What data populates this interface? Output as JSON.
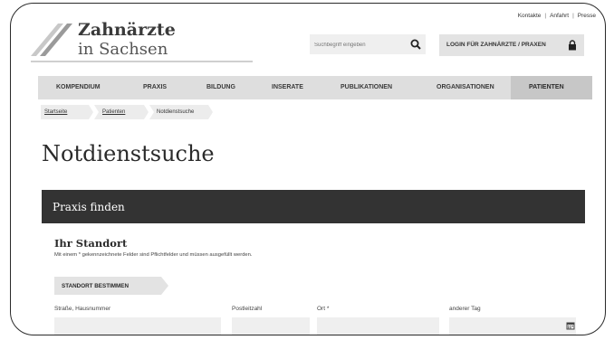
{
  "header": {
    "logo_line1": "Zahnärzte",
    "logo_line2": "in Sachsen",
    "top_links": [
      "Kontakte",
      "Anfahrt",
      "Presse"
    ],
    "top_link_separator": "|",
    "search_placeholder": "Suchbegriff eingeben",
    "search_icon": "search-icon",
    "login_label": "LOGIN FÜR ZAHNÄRZTE / PRAXEN",
    "login_icon": "lock-icon"
  },
  "nav": {
    "items": [
      "KOMPENDIUM",
      "PRAXIS",
      "BILDUNG",
      "INSERATE",
      "PUBLIKATIONEN",
      "ORGANISATIONEN"
    ],
    "active": "PATIENTEN"
  },
  "breadcrumb": [
    "Startseite",
    "Patienten",
    "Notdienstsuche"
  ],
  "page_title": "Notdienstsuche",
  "panel": {
    "title": "Praxis finden"
  },
  "location": {
    "title": "Ihr Standort",
    "hint": "Mit einem * gekennzeichnete Felder sind Pflichtfelder und müssen ausgefüllt werden.",
    "button": "STANDORT BESTIMMEN"
  },
  "form": {
    "street_label": "Straße, Hausnummer",
    "zip_label": "Postleitzahl",
    "city_label": "Ort *",
    "day_label": "anderer Tag",
    "calendar_icon": "calendar-icon"
  }
}
